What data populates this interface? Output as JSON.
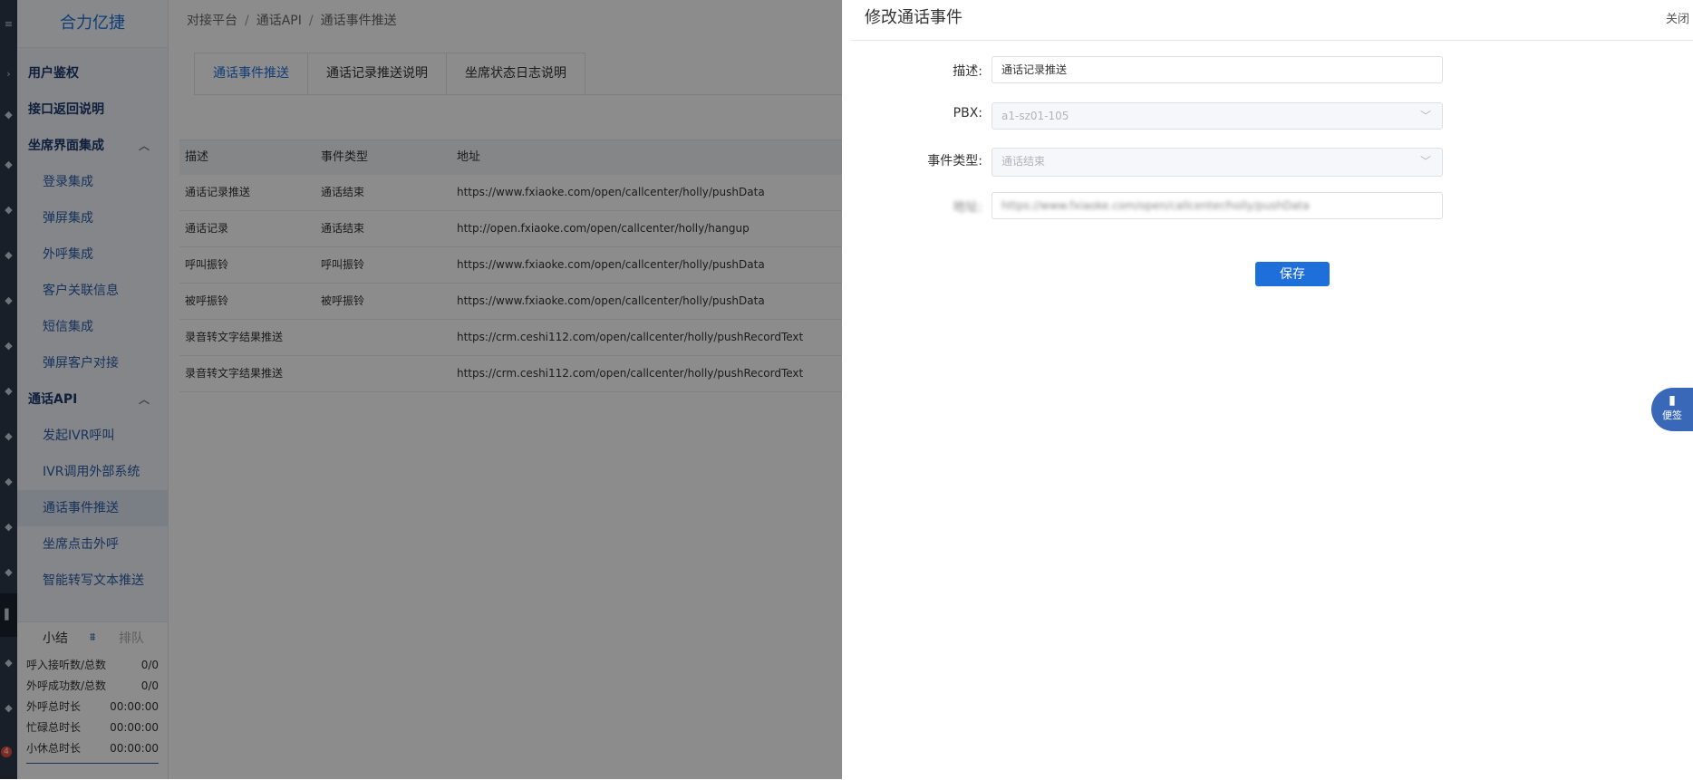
{
  "app": {
    "brand": "合力亿捷"
  },
  "rail": {
    "badge": "4"
  },
  "sidebar": {
    "items": [
      {
        "label": "用户鉴权",
        "level": "top"
      },
      {
        "label": "接口返回说明",
        "level": "top"
      },
      {
        "label": "坐席界面集成",
        "level": "top",
        "expanded": true
      },
      {
        "label": "登录集成",
        "level": "sub"
      },
      {
        "label": "弹屏集成",
        "level": "sub"
      },
      {
        "label": "外呼集成",
        "level": "sub"
      },
      {
        "label": "客户关联信息",
        "level": "sub"
      },
      {
        "label": "短信集成",
        "level": "sub"
      },
      {
        "label": "弹屏客户对接",
        "level": "sub"
      },
      {
        "label": "通话API",
        "level": "top",
        "expanded": true
      },
      {
        "label": "发起IVR呼叫",
        "level": "sub"
      },
      {
        "label": "IVR调用外部系统",
        "level": "sub"
      },
      {
        "label": "通话事件推送",
        "level": "sub",
        "active": true
      },
      {
        "label": "坐席点击外呼",
        "level": "sub"
      },
      {
        "label": "智能转写文本推送",
        "level": "sub"
      }
    ]
  },
  "stats": {
    "tab_summary": "小结",
    "tab_queue": "排队",
    "rows": [
      {
        "label": "呼入接听数/总数",
        "value": "0/0"
      },
      {
        "label": "外呼成功数/总数",
        "value": "0/0"
      },
      {
        "label": "外呼总时长",
        "value": "00:00:00"
      },
      {
        "label": "忙碌总时长",
        "value": "00:00:00"
      },
      {
        "label": "小休总时长",
        "value": "00:00:00"
      }
    ]
  },
  "breadcrumb": [
    "对接平台",
    "通话API",
    "通话事件推送"
  ],
  "tabs": [
    {
      "label": "通话事件推送",
      "active": true
    },
    {
      "label": "通话记录推送说明"
    },
    {
      "label": "坐席状态日志说明"
    }
  ],
  "table": {
    "headers": [
      "描述",
      "事件类型",
      "地址"
    ],
    "rows": [
      [
        "通话记录推送",
        "通话结束",
        "https://www.fxiaoke.com/open/callcenter/holly/pushData"
      ],
      [
        "通话记录",
        "通话结束",
        "http://open.fxiaoke.com/open/callcenter/holly/hangup"
      ],
      [
        "呼叫振铃",
        "呼叫振铃",
        "https://www.fxiaoke.com/open/callcenter/holly/pushData"
      ],
      [
        "被呼振铃",
        "被呼振铃",
        "https://www.fxiaoke.com/open/callcenter/holly/pushData"
      ],
      [
        "录音转文字结果推送",
        "",
        "https://crm.ceshi112.com/open/callcenter/holly/pushRecordText"
      ],
      [
        "录音转文字结果推送",
        "",
        "https://crm.ceshi112.com/open/callcenter/holly/pushRecordText"
      ]
    ]
  },
  "drawer": {
    "title": "修改通话事件",
    "close": "关闭",
    "fields": {
      "desc_label": "描述:",
      "desc_value": "通话记录推送",
      "pbx_label": "PBX:",
      "pbx_value": "a1-sz01-105",
      "event_label": "事件类型:",
      "event_value": "通话结束",
      "addr_label": "地址:",
      "addr_value": "https://www.fxiaoke.com/open/callcenter/holly/pushData"
    },
    "save": "保存"
  },
  "floating": {
    "note": "便签"
  },
  "colors": {
    "primary": "#1e6fd9",
    "sidebar_bg": "#f2f5fa",
    "rail_bg": "#2c3a4a",
    "overlay": "rgba(0,0,0,0.45)"
  }
}
